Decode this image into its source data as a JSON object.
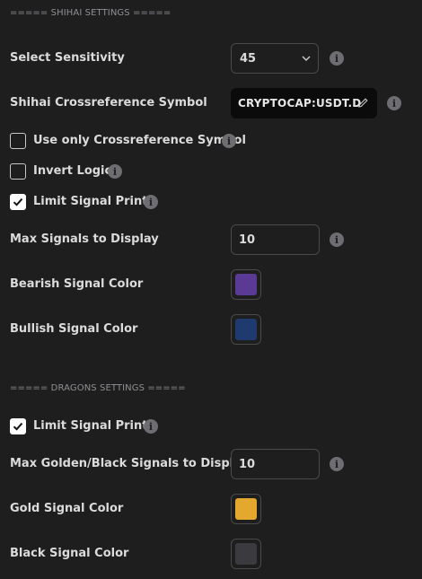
{
  "shihai": {
    "header": "===== SHIHAI SETTINGS =====",
    "sensitivity": {
      "label": "Select Sensitivity",
      "value": "45"
    },
    "symbol": {
      "label": "Shihai Crossreference Symbol",
      "value": "CRYPTOCAP:USDT.D"
    },
    "use_only_symbol": {
      "label": "Use only Crossreference Symbol",
      "checked": false
    },
    "invert_logic": {
      "label": "Invert Logic",
      "checked": false
    },
    "limit_prints": {
      "label": "Limit Signal Prints",
      "checked": true
    },
    "max_signals": {
      "label": "Max Signals to Display",
      "value": "10"
    },
    "bearish_color": {
      "label": "Bearish Signal Color",
      "color": "#5b3a96"
    },
    "bullish_color": {
      "label": "Bullish Signal Color",
      "color": "#1e3a6e"
    }
  },
  "dragons": {
    "header": "===== DRAGONS SETTINGS =====",
    "limit_prints": {
      "label": "Limit Signal Prints",
      "checked": true
    },
    "max_signals": {
      "label": "Max Golden/Black Signals to Display",
      "value": "10"
    },
    "gold_color": {
      "label": "Gold Signal Color",
      "color": "#e5a82e"
    },
    "black_color": {
      "label": "Black Signal Color",
      "color": "#3a3a3f"
    }
  },
  "icons": {
    "info": "info-icon",
    "chevron": "chevron-down-icon",
    "pencil": "pencil-icon",
    "check": "check-icon"
  }
}
